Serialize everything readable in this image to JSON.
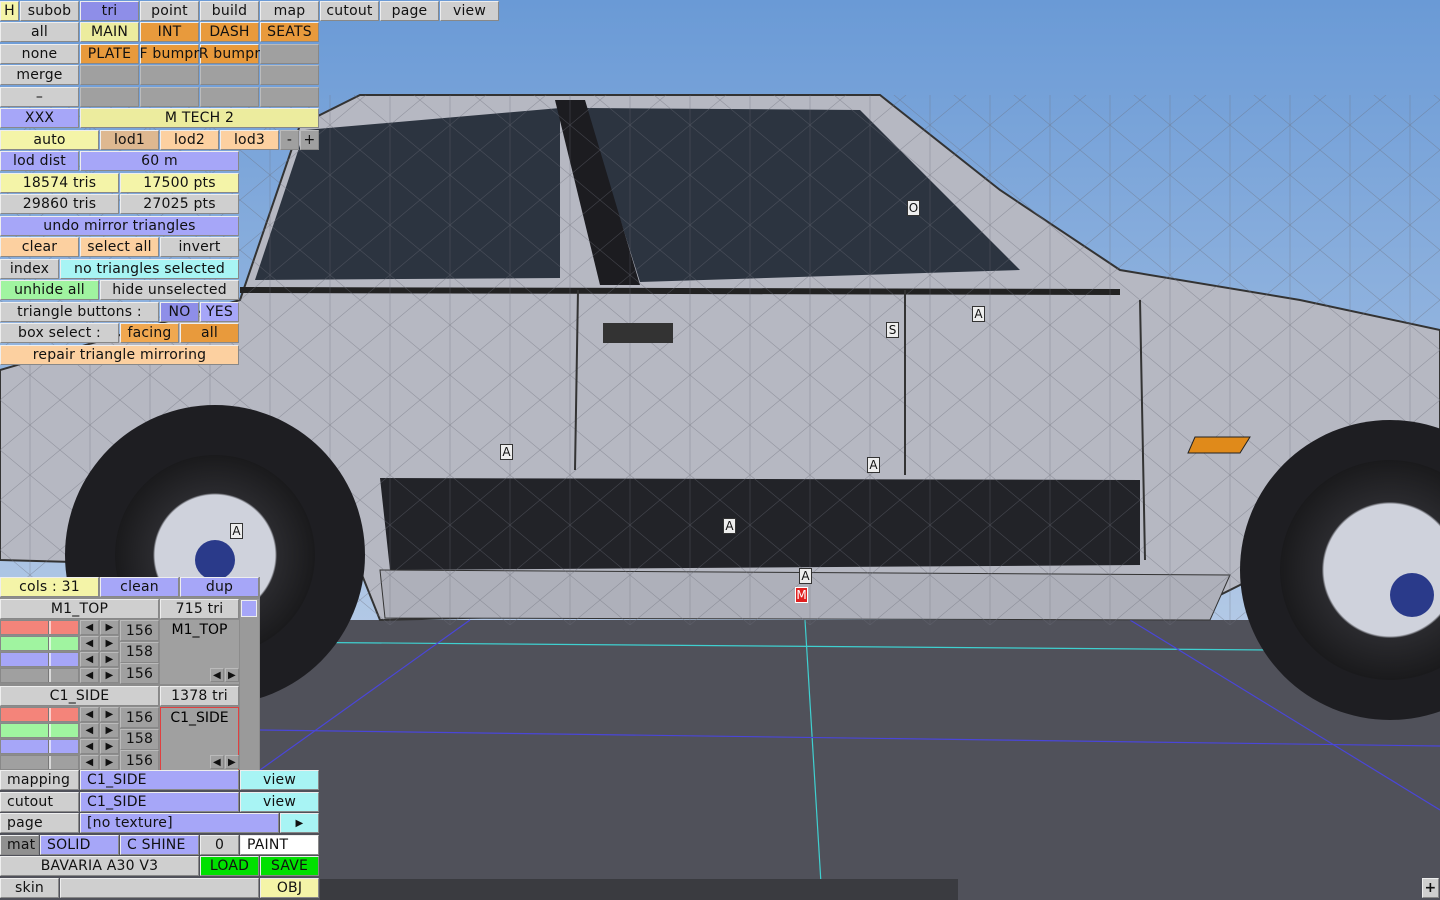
{
  "top_tabs": {
    "h": "H",
    "subob": "subob",
    "tri": "tri",
    "point": "point",
    "build": "build",
    "map": "map",
    "cutout": "cutout",
    "page": "page",
    "view": "view"
  },
  "groups": {
    "all": "all",
    "none": "none",
    "merge": "merge",
    "minus": "–",
    "items": [
      "MAIN",
      "INT",
      "DASH",
      "SEATS",
      "PLATE",
      "F bumpr",
      "R bumpr"
    ]
  },
  "model": {
    "xxx": "XXX",
    "name": "M TECH 2"
  },
  "lod": {
    "auto": "auto",
    "lod1": "lod1",
    "lod2": "lod2",
    "lod3": "lod3",
    "minus": "-",
    "plus": "+",
    "dist_label": "lod dist",
    "dist_value": "60 m"
  },
  "stats": {
    "tris1": "18574 tris",
    "pts1": "17500 pts",
    "tris2": "29860 tris",
    "pts2": "27025 pts"
  },
  "tri_tools": {
    "undo_mirror": "undo mirror triangles",
    "clear": "clear",
    "select_all": "select all",
    "invert": "invert",
    "index": "index",
    "selection_status": "no triangles selected",
    "unhide_all": "unhide all",
    "hide_unselected": "hide unselected",
    "triangle_buttons": "triangle buttons :",
    "no": "NO",
    "yes": "YES",
    "box_select": "box select :",
    "facing": "facing",
    "all": "all",
    "repair": "repair triangle mirroring"
  },
  "cols": {
    "label": "cols : 31",
    "clean": "clean",
    "dup": "dup"
  },
  "materials": [
    {
      "name": "M1_TOP",
      "tri": "715 tri",
      "r": "156",
      "g": "158",
      "b": "156",
      "preview": "M1_TOP",
      "slider_frac": 0.61
    },
    {
      "name": "C1_SIDE",
      "tri": "1378 tri",
      "r": "156",
      "g": "158",
      "b": "156",
      "preview": "C1_SIDE",
      "slider_frac": 0.61
    }
  ],
  "bottom": {
    "mapping": "mapping",
    "mapping_val": "C1_SIDE",
    "view1": "view",
    "cutout": "cutout",
    "cutout_val": "C1_SIDE",
    "view2": "view",
    "page": "page",
    "page_val": "[no texture]",
    "page_arrow": "▶",
    "mat": "mat",
    "solid": "SOLID",
    "shine": "C SHINE",
    "zero": "0",
    "paint": "PAINT",
    "file": "BAVARIA A30 V3",
    "load": "LOAD",
    "save": "SAVE",
    "skin": "skin",
    "obj": "OBJ",
    "plus": "+"
  },
  "markers": {
    "o": "O",
    "s": "S",
    "a": "A",
    "m": "M"
  }
}
